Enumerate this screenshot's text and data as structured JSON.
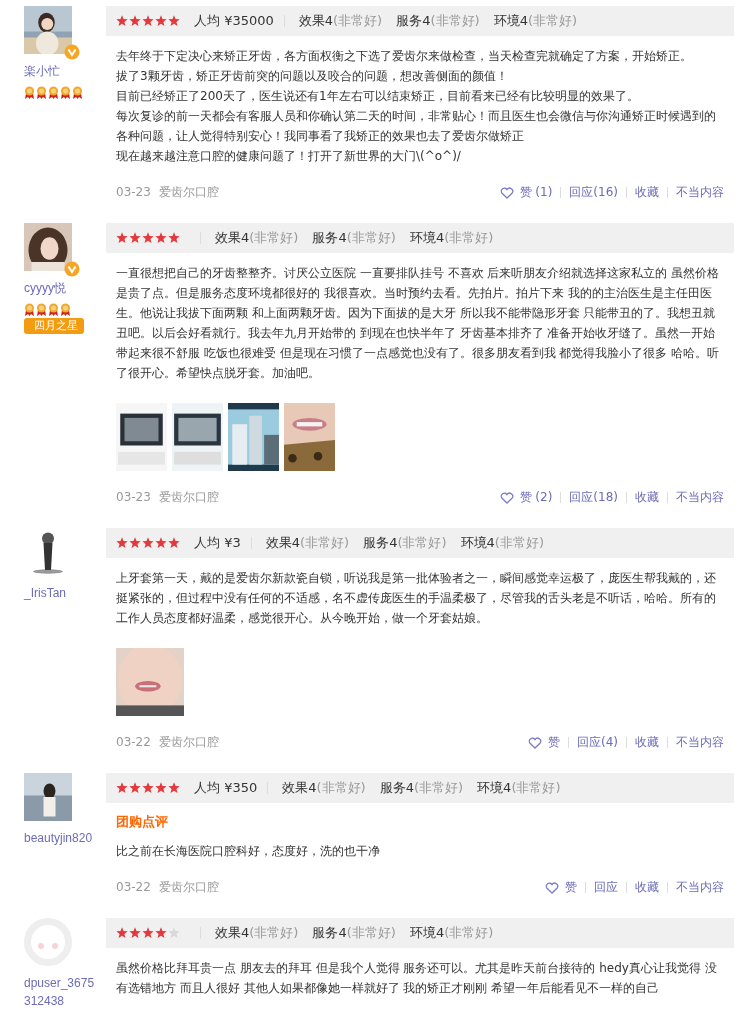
{
  "reviews": [
    {
      "user": {
        "name": "楽小忙",
        "avatar": {
          "kind": "picture"
        },
        "verified": true,
        "medals": [
          {
            "kind": "medal"
          },
          {
            "kind": "medal"
          },
          {
            "kind": "medal"
          },
          {
            "kind": "medal"
          },
          {
            "kind": "medal"
          }
        ]
      },
      "stars": 5,
      "price": "人均 ¥35000",
      "ratings": [
        {
          "label": "效果",
          "score": "4",
          "desc": "(非常好)"
        },
        {
          "label": "服务",
          "score": "4",
          "desc": "(非常好)"
        },
        {
          "label": "环境",
          "score": "4",
          "desc": "(非常好)"
        }
      ],
      "paragraphs": [
        "去年终于下定决心来矫正牙齿，各方面权衡之下选了爱齿尔来做检查，当天检查完就确定了方案，开始矫正。",
        "拔了3颗牙齿，矫正牙齿前突的问题以及咬合的问题，想改善侧面的颜值！",
        "目前已经矫正了200天了，医生说还有1年左右可以结束矫正，目前看来已经有比较明显的效果了。",
        "每次复诊的前一天都会有客服人员和你确认第二天的时间，非常贴心！而且医生也会微信与你沟通矫正时候遇到的各种问题，让人觉得特别安心！我同事看了我矫正的效果也去了爱齿尔做矫正",
        "现在越来越注意口腔的健康问题了！打开了新世界的大门\\(^o^)/"
      ],
      "date": "03-23",
      "shop": "爱齿尔口腔",
      "actions": {
        "like": "赞 (1)",
        "reply": "回应(16)",
        "favorite": "收藏",
        "report": "不当内容"
      }
    },
    {
      "user": {
        "name": "cyyyy悦",
        "avatar": {
          "kind": "picture"
        },
        "verified": true,
        "medals": [
          {
            "kind": "medal"
          },
          {
            "kind": "medal"
          },
          {
            "kind": "medal"
          },
          {
            "kind": "medal"
          }
        ],
        "badge": "四月之星"
      },
      "stars": 5,
      "ratings": [
        {
          "label": "效果",
          "score": "4",
          "desc": "(非常好)"
        },
        {
          "label": "服务",
          "score": "4",
          "desc": "(非常好)"
        },
        {
          "label": "环境",
          "score": "4",
          "desc": "(非常好)"
        }
      ],
      "paragraphs": [
        "一直很想把自己的牙齿整整齐。讨厌公立医院 一直要排队挂号 不喜欢 后来听朋友介绍就选择这家私立的 虽然价格是贵了点。但是服务态度环境都很好的 我很喜欢。当时预约去看。先拍片。拍片下来 我的的主治医生是主任田医生。他说让我拔下面两颗 和上面两颗牙齿。因为下面拔的是大牙 所以我不能带隐形牙套 只能带丑的了。我想丑就丑吧。以后会好看就行。我去年九月开始带的 到现在也快半年了 牙齿基本排齐了 准备开始收牙缝了。虽然一开始带起来很不舒服 吃饭也很难受 但是现在习惯了一点感觉也没有了。很多朋友看到我 都觉得我脸小了很多 哈哈。听了很开心。希望快点脱牙套。加油吧。"
      ],
      "photos": [
        {
          "kind": "picture"
        },
        {
          "kind": "picture"
        },
        {
          "kind": "picture"
        },
        {
          "kind": "picture"
        }
      ],
      "date": "03-23",
      "shop": "爱齿尔口腔",
      "actions": {
        "like": "赞 (2)",
        "reply": "回应(18)",
        "favorite": "收藏",
        "report": "不当内容"
      }
    },
    {
      "user": {
        "name": "_IrisTan",
        "avatar": {
          "kind": "picture"
        },
        "verified": false
      },
      "stars": 5,
      "price": "人均 ¥3",
      "ratings": [
        {
          "label": "效果",
          "score": "4",
          "desc": "(非常好)"
        },
        {
          "label": "服务",
          "score": "4",
          "desc": "(非常好)"
        },
        {
          "label": "环境",
          "score": "4",
          "desc": "(非常好)"
        }
      ],
      "paragraphs": [
        "上牙套第一天，戴的是爱齿尔新款瓷自锁，听说我是第一批体验者之一，瞬间感觉幸运极了，庞医生帮我戴的，还挺紧张的，但过程中没有任何的不适感，名不虚传庞医生的手温柔极了，尽管我的舌头老是不听话，哈哈。所有的工作人员态度都好温柔，感觉很开心。从今晚开始，做一个牙套姑娘。"
      ],
      "photos": [
        {
          "kind": "picture"
        }
      ],
      "date": "03-22",
      "shop": "爱齿尔口腔",
      "actions": {
        "like": "赞",
        "reply": "回应(4)",
        "favorite": "收藏",
        "report": "不当内容"
      }
    },
    {
      "user": {
        "name": "beautyjin820",
        "avatar": {
          "kind": "picture"
        },
        "verified": false
      },
      "stars": 5,
      "price": "人均 ¥350",
      "ratings": [
        {
          "label": "效果",
          "score": "4",
          "desc": "(非常好)"
        },
        {
          "label": "服务",
          "score": "4",
          "desc": "(非常好)"
        },
        {
          "label": "环境",
          "score": "4",
          "desc": "(非常好)"
        }
      ],
      "tag": "团购点评",
      "paragraphs": [
        "比之前在长海医院口腔科好，态度好，洗的也干净"
      ],
      "date": "03-22",
      "shop": "爱齿尔口腔",
      "actions": {
        "like": "赞",
        "reply": "回应",
        "favorite": "收藏",
        "report": "不当内容"
      }
    },
    {
      "user": {
        "name": "dpuser_3675312438",
        "avatar": {
          "kind": "default"
        },
        "verified": false
      },
      "stars": 4,
      "ratings": [
        {
          "label": "效果",
          "score": "4",
          "desc": "(非常好)"
        },
        {
          "label": "服务",
          "score": "4",
          "desc": "(非常好)"
        },
        {
          "label": "环境",
          "score": "4",
          "desc": "(非常好)"
        }
      ],
      "paragraphs": [
        "虽然价格比拜耳贵一点 朋友去的拜耳 但是我个人觉得 服务还可以。尤其是昨天前台接待的 hedy真心让我觉得 没有选错地方 而且人很好 其他人如果都像她一样就好了 我的矫正才刚刚 希望一年后能看见不一样的自己"
      ]
    }
  ]
}
